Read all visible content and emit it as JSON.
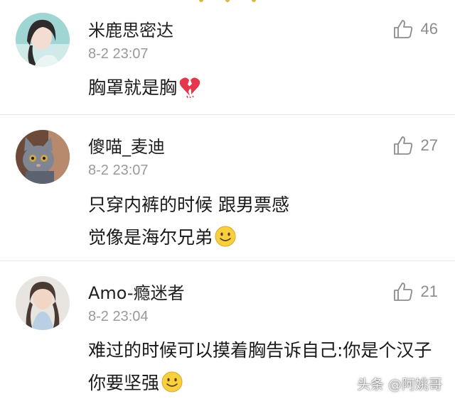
{
  "comments": [
    {
      "username": "米鹿思密达",
      "timestamp": "8-2 23:07",
      "likes": "46",
      "text": "胸罩就是胸",
      "trailing_emoji": "broken-heart"
    },
    {
      "username": "傻喵_麦迪",
      "timestamp": "8-2 23:07",
      "likes": "27",
      "text": "只穿内裤的时候 跟男票感觉像是海尔兄弟",
      "trailing_emoji": "smile"
    },
    {
      "username": "Amo-瘾迷者",
      "timestamp": "8-2 23:04",
      "likes": "21",
      "text": "难过的时候可以摸着胸告诉自己:你是个汉子 你要坚强",
      "trailing_emoji": "smile"
    }
  ],
  "watermark": "头条 @阿姚哥",
  "colors": {
    "accent_like": "#8c8c8c",
    "broken_heart": "#e5364b",
    "emoji_face": "#f7cf3f"
  }
}
